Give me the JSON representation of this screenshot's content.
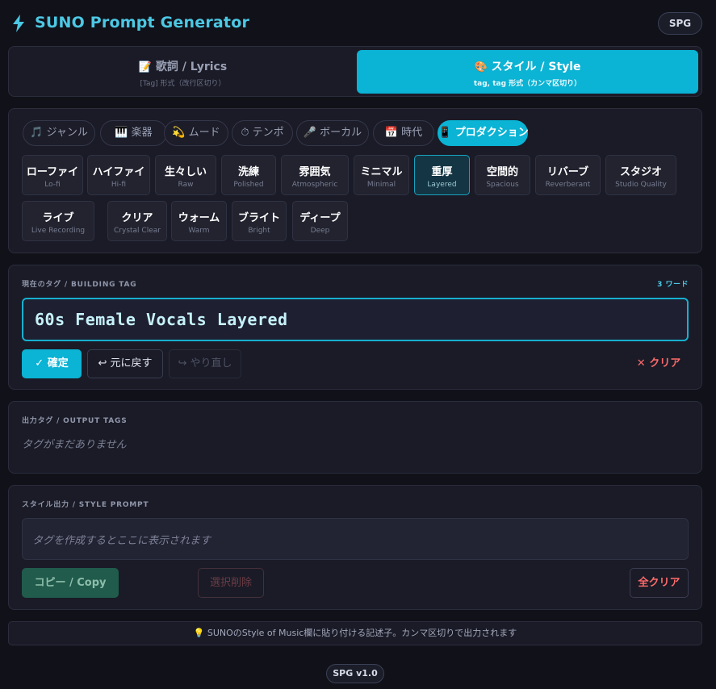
{
  "app": {
    "title": "SUNO Prompt Generator",
    "badge": "SPG",
    "version": "SPG v1.0"
  },
  "mode_tabs": [
    {
      "icon": "📝",
      "label": "歌詞 / Lyrics",
      "sub": "[Tag] 形式（改行区切り）",
      "active": false
    },
    {
      "icon": "🎨",
      "label": "スタイル / Style",
      "sub": "tag, tag 形式（カンマ区切り）",
      "active": true
    }
  ],
  "category_tabs": [
    {
      "icon": "🎵",
      "label": "ジャンル"
    },
    {
      "icon": "🎹",
      "label": "楽器"
    },
    {
      "icon": "💫",
      "label": "ムード"
    },
    {
      "icon": "⏱",
      "label": "テンポ"
    },
    {
      "icon": "🎤",
      "label": "ボーカル"
    },
    {
      "icon": "📅",
      "label": "時代"
    },
    {
      "icon": "📱",
      "label": "プロダクション",
      "active": true
    }
  ],
  "tags": [
    {
      "jp": "ローファイ",
      "en": "Lo-fi"
    },
    {
      "jp": "ハイファイ",
      "en": "Hi-fi"
    },
    {
      "jp": "生々しい",
      "en": "Raw"
    },
    {
      "jp": "洗練",
      "en": "Polished"
    },
    {
      "jp": "雰囲気",
      "en": "Atmospheric"
    },
    {
      "jp": "ミニマル",
      "en": "Minimal"
    },
    {
      "jp": "重厚",
      "en": "Layered",
      "active": true
    },
    {
      "jp": "空間的",
      "en": "Spacious"
    },
    {
      "jp": "リバーブ",
      "en": "Reverberant"
    },
    {
      "jp": "スタジオ",
      "en": "Studio Quality"
    },
    {
      "jp": "ライブ",
      "en": "Live Recording"
    },
    {
      "jp": "クリア",
      "en": "Crystal Clear"
    },
    {
      "jp": "ウォーム",
      "en": "Warm"
    },
    {
      "jp": "ブライト",
      "en": "Bright"
    },
    {
      "jp": "ディープ",
      "en": "Deep"
    }
  ],
  "builder": {
    "label": "現在のタグ / BUILDING TAG",
    "word_count": "3 ワード",
    "value": "60s Female Vocals Layered",
    "confirm": "✓ 確定",
    "undo": "↩ 元に戻す",
    "redo": "↪ やり直し",
    "clear": "✕ クリア"
  },
  "output_tags": {
    "label": "出力タグ / OUTPUT TAGS",
    "empty": "タグがまだありません"
  },
  "style_prompt": {
    "label": "スタイル出力 / STYLE PROMPT",
    "placeholder": "タグを作成するとここに表示されます",
    "copy": "コピー / Copy",
    "delete_selected": "選択削除",
    "clear_all": "全クリア"
  },
  "hint": "💡 SUNOのStyle of Music欄に貼り付ける記述子。カンマ区切りで出力されます",
  "colors": {
    "accent": "#0bb3d4",
    "title": "#4cc8e4",
    "danger": "#ff6b6b",
    "background": "#111119",
    "panel": "#1a1b27"
  }
}
